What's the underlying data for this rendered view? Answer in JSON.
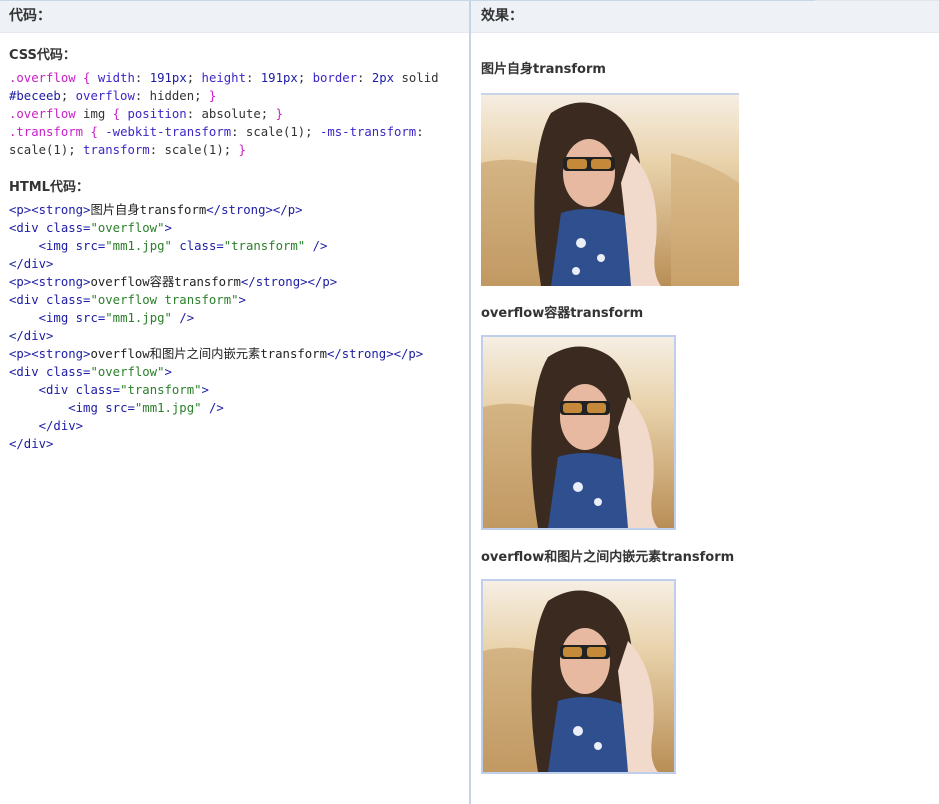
{
  "left_panel": {
    "header": "代码：",
    "css_heading": "CSS代码：",
    "html_heading": "HTML代码："
  },
  "right_panel": {
    "header": "效果：",
    "demos": [
      {
        "title": "图片自身transform"
      },
      {
        "title": "overflow容器transform"
      },
      {
        "title": "overflow和图片之间内嵌元素transform"
      }
    ]
  },
  "colors": {
    "box_border": "#beceeb",
    "header_bg": "#eef2f7",
    "divider": "#c6d4ea"
  },
  "image": {
    "file": "mm1.jpg"
  },
  "icons": [
    "photo-of-woman-with-sunglasses"
  ]
}
